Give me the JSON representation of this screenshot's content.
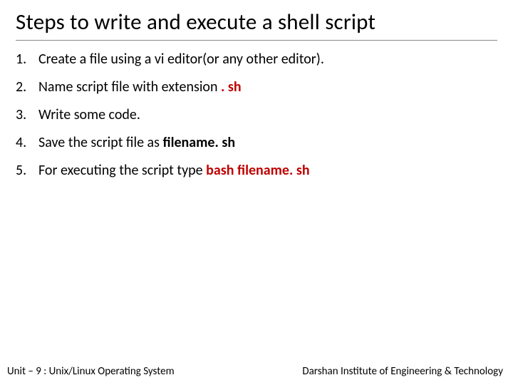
{
  "title": "Steps to write and execute a shell script",
  "items": [
    {
      "plain": "Create a file using a vi editor(or any other editor)."
    },
    {
      "plain": "Name  script file with extension",
      "red": " . sh"
    },
    {
      "plain": "Write some code."
    },
    {
      "plain": "Save the script file as ",
      "bold": "filename. sh"
    },
    {
      "plain": "For executing the script type ",
      "redbold": "bash filename. sh"
    }
  ],
  "footer": {
    "left": "Unit – 9  : Unix/Linux Operating System",
    "right": "Darshan Institute of Engineering & Technology"
  }
}
